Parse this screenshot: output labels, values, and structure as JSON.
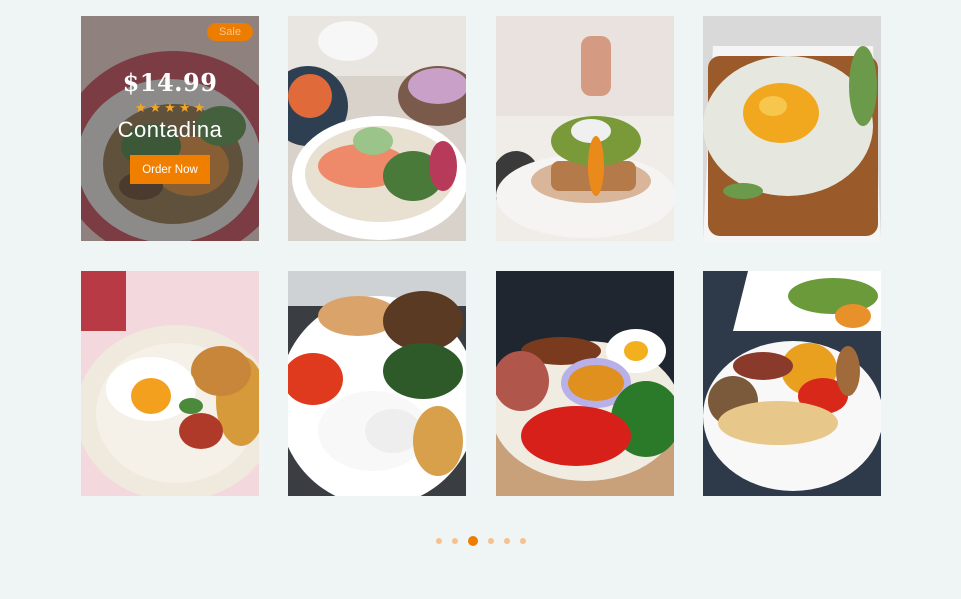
{
  "gallery": {
    "items": [
      {
        "alt": "Bowl salad with grated carrot and greens",
        "featured": true
      },
      {
        "alt": "Salmon salad bowl with sprouts"
      },
      {
        "alt": "Avocado toast with poached egg"
      },
      {
        "alt": "Fried egg on toast"
      },
      {
        "alt": "Fried eggs with potatoes and tomato"
      },
      {
        "alt": "Full breakfast with mushrooms, eggs and spinach"
      },
      {
        "alt": "Full English breakfast with beans"
      },
      {
        "alt": "Breakfast plate with hash brown and sausages"
      }
    ]
  },
  "featured": {
    "sale_label": "Sale",
    "price": "$14.99",
    "rating": 5,
    "stars": [
      "★",
      "★",
      "★",
      "★",
      "★"
    ],
    "name": "Contadina",
    "order_label": "Order Now"
  },
  "pagination": {
    "count": 6,
    "active_index": 2
  },
  "colors": {
    "accent": "#ec7d00",
    "background": "#eff4f5",
    "dot_inactive": "#f6c08f",
    "star": "#f5a623"
  }
}
